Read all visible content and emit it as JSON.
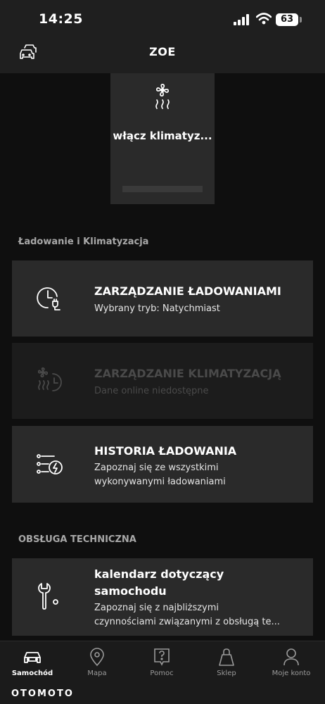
{
  "status_bar": {
    "time": "14:25",
    "battery": "63"
  },
  "header": {
    "title": "ZOE",
    "left_icon": "car-switch-icon"
  },
  "climate_tile": {
    "label": "włącz klimatyz...",
    "icon": "fan-heat-icon"
  },
  "sections": {
    "charging": {
      "title": "Ładowanie i Klimatyzacja",
      "cards": [
        {
          "title": "ZARZĄDZANIE ŁADOWANIAMI",
          "subtitle": "Wybrany tryb: Natychmiast",
          "icon": "clock-plug-icon",
          "enabled": true
        },
        {
          "title": "ZARZĄDZANIE KLIMATYZACJĄ",
          "subtitle": "Dane online niedostępne",
          "icon": "fan-clock-icon",
          "enabled": false
        },
        {
          "title": "HISTORIA ŁADOWANIA",
          "subtitle_line1": "Zapoznaj się ze wszystkimi",
          "subtitle_line2": "wykonywanymi ładowaniami",
          "icon": "charging-history-icon",
          "enabled": true
        }
      ]
    },
    "service": {
      "title": "OBSŁUGA TECHNICZNA",
      "card": {
        "title_line1": "kalendarz dotyczący",
        "title_line2": "samochodu",
        "subtitle_line1": "Zapoznaj się z najbliższymi",
        "subtitle_line2": "czynnościami związanymi z obsługą te...",
        "icon": "wrench-icon"
      }
    }
  },
  "bottom_nav": {
    "items": [
      {
        "label": "Samochód",
        "icon": "car-icon",
        "active": true
      },
      {
        "label": "Mapa",
        "icon": "map-pin-icon",
        "active": false
      },
      {
        "label": "Pomoc",
        "icon": "help-icon",
        "active": false
      },
      {
        "label": "Sklep",
        "icon": "shopping-bag-icon",
        "active": false
      },
      {
        "label": "Moje konto",
        "icon": "user-icon",
        "active": false
      }
    ]
  },
  "watermark": "OTOMOTO",
  "colors": {
    "background": "#0f0f0f",
    "card": "#2a2a2a",
    "card_disabled": "#1c1c1c",
    "bar": "#1f1f1f",
    "text_primary": "#ffffff",
    "text_muted": "#a8a8a8",
    "text_disabled": "#4a4a4a"
  }
}
